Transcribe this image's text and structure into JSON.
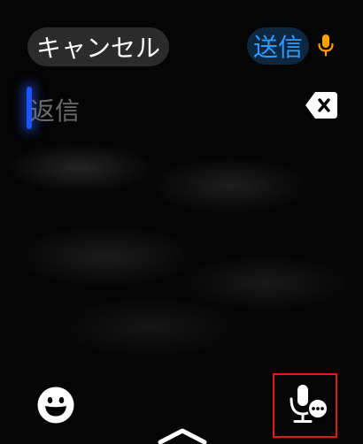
{
  "header": {
    "cancel_label": "キャンセル",
    "send_label": "送信"
  },
  "compose": {
    "placeholder": "返信"
  },
  "icons": {
    "top_mic": "microphone-icon",
    "backspace": "backspace-icon",
    "emoji": "emoji-icon",
    "dictation": "dictation-microphone-icon",
    "show_more": "chevron-up-icon"
  },
  "colors": {
    "send_text": "#2f9cff",
    "send_bg": "#0e2740",
    "cancel_bg": "#2b2b2b",
    "mic_accent": "#ff9f0a",
    "cursor": "#1a56ff",
    "highlight_box": "#e21b1b"
  }
}
